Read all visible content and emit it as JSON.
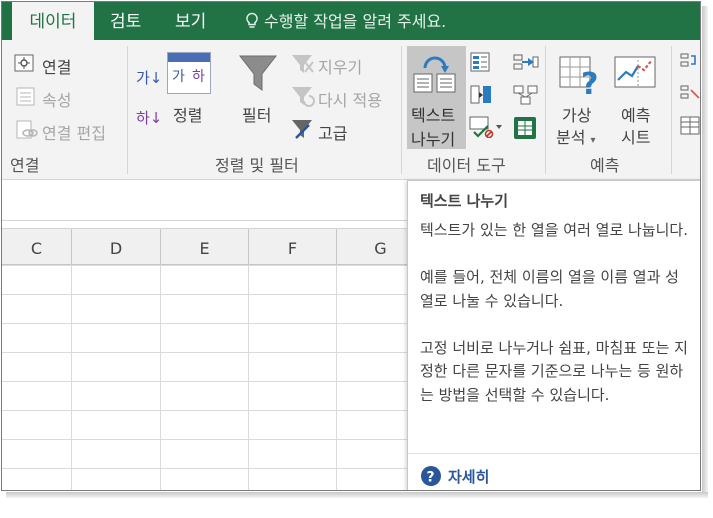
{
  "tabs": {
    "data": "데이터",
    "review": "검토",
    "view": "보기",
    "tell_me": "수행할 작업을 알려 주세요."
  },
  "ribbon": {
    "connections": {
      "connections_label": "연결",
      "properties_label": "속성",
      "edit_links_label": "연결 편집",
      "group_label": "연결"
    },
    "sort_filter": {
      "sort_label": "정렬",
      "filter_label": "필터",
      "clear_label": "지우기",
      "reapply_label": "다시 적용",
      "advanced_label": "고급",
      "group_label": "정렬 및 필터",
      "sort_az_glyph": "가↓",
      "sort_za_glyph": "하↓",
      "sort_icon_left": "가",
      "sort_icon_right": "하"
    },
    "data_tools": {
      "text_to_columns_line1": "텍스트",
      "text_to_columns_line2": "나누기",
      "group_label": "데이터 도구"
    },
    "forecast": {
      "what_if_line1": "가상",
      "what_if_line2": "분석",
      "forecast_line1": "예측",
      "forecast_line2": "시트",
      "group_label": "예측"
    }
  },
  "sheet": {
    "columns": [
      "C",
      "D",
      "E",
      "F",
      "G"
    ]
  },
  "tooltip": {
    "title": "텍스트 나누기",
    "paragraph1": "텍스트가 있는 한 열을 여러 열로 나눕니다.",
    "paragraph2": "예를 들어, 전체 이름의 열을 이름 열과 성 열로 나눌 수 있습니다.",
    "paragraph3": "고정 너비로 나누거나 쉼표, 마침표 또는 지정한 다른 문자를 기준으로 나누는 등 원하는 방법을 선택할 수 있습니다.",
    "more_label": "자세히"
  },
  "colors": {
    "excel_green": "#217346",
    "ribbon_bg": "#f3f3f3",
    "link_blue": "#2b579a"
  }
}
